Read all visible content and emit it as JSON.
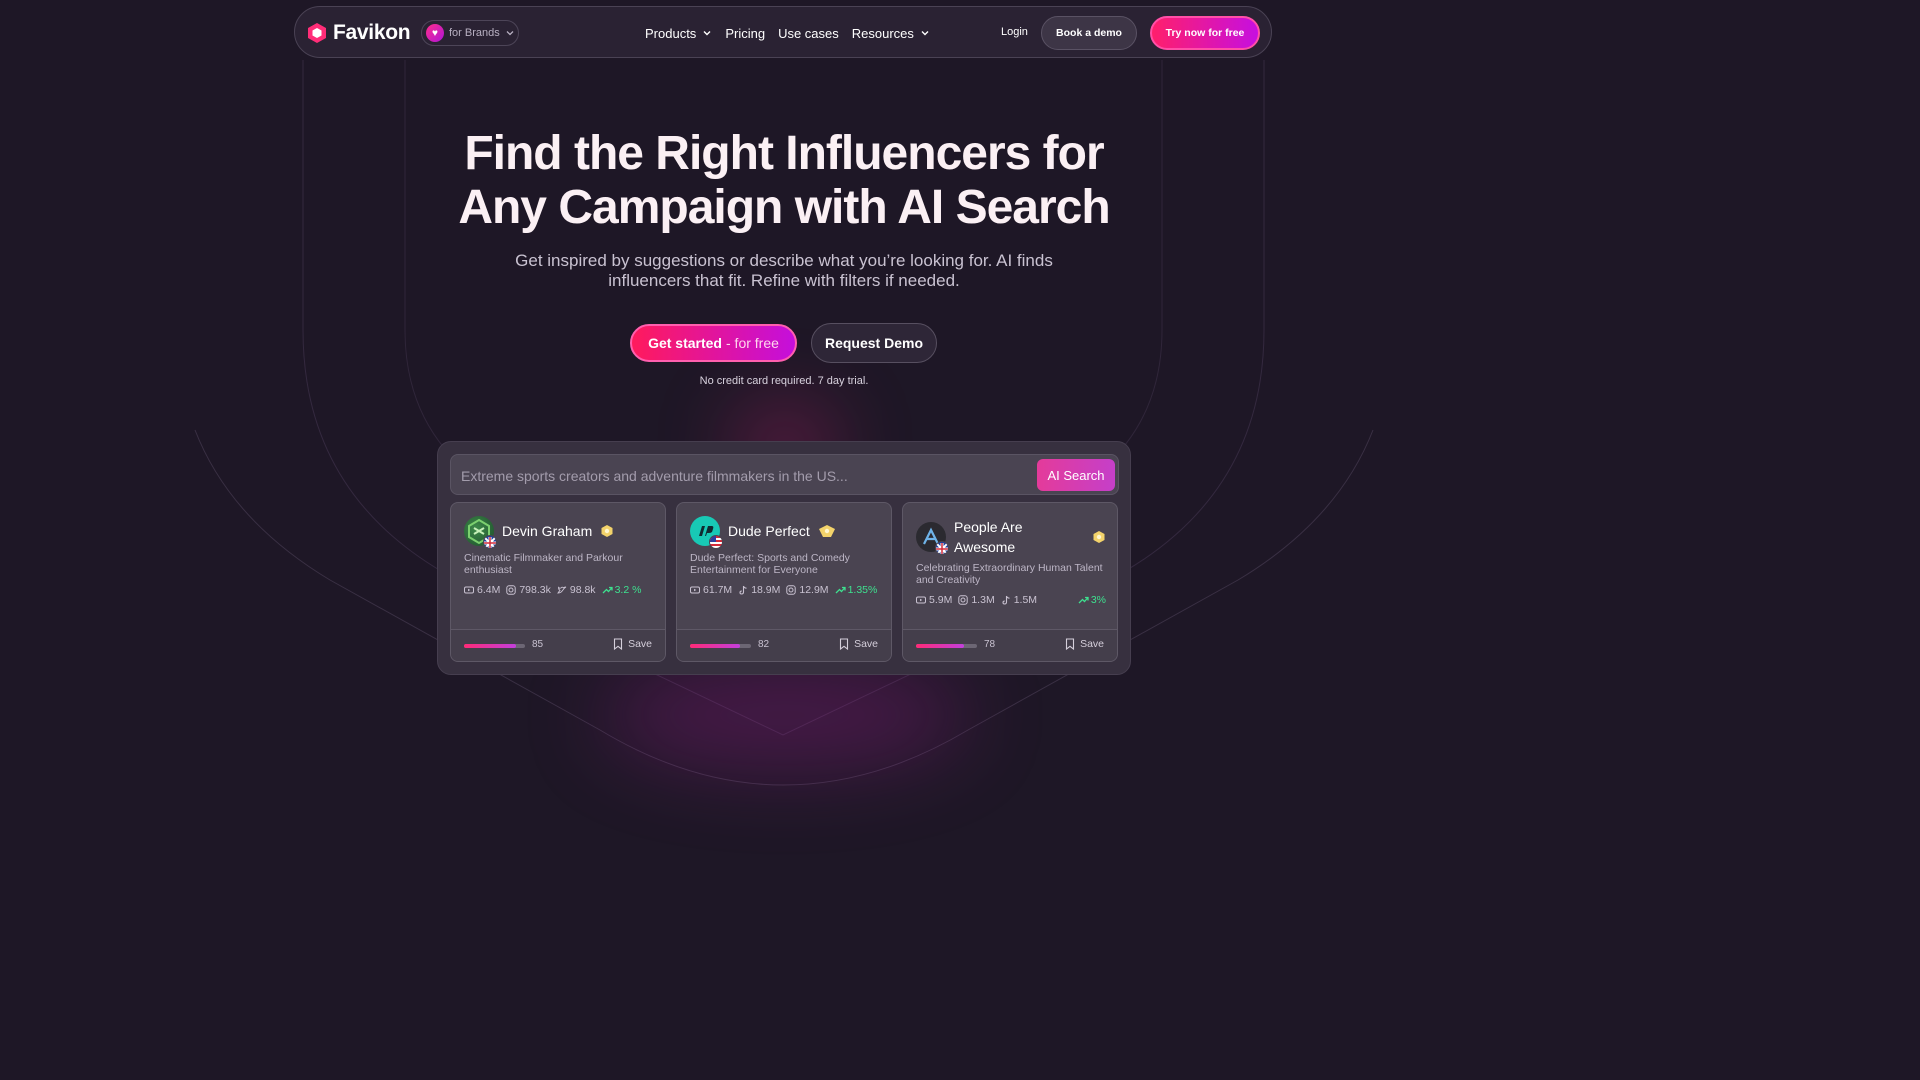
{
  "nav": {
    "logo_text": "Favikon",
    "brand_switch": "for Brands",
    "links": [
      "Products",
      "Pricing",
      "Use cases",
      "Resources"
    ],
    "login": "Login",
    "book_demo": "Book a demo",
    "try_now": "Try now for free"
  },
  "hero": {
    "headline_line1": "Find the Right Influencers for",
    "headline_line2": "Any Campaign with AI Search",
    "subline_line1": "Get inspired by suggestions or describe what you’re looking for. AI finds",
    "subline_line2": "influencers that fit. Refine with filters if needed.",
    "cta_primary": "Get started",
    "cta_primary_suffix": "- for free",
    "cta_secondary": "Request Demo",
    "note": "No credit card required. 7 day trial."
  },
  "search": {
    "placeholder": "Extreme sports creators and adventure filmmakers in the US...",
    "button": "AI Search"
  },
  "cards": [
    {
      "name": "Devin Graham",
      "description": "Cinematic Filmmaker and Parkour enthusiast",
      "stat1": "6.4M",
      "stat2": "798.3k",
      "stat3": "98.8k",
      "growth": "3.2 %",
      "score": "85",
      "score_fraction": 0.85,
      "save": "Save"
    },
    {
      "name": "Dude Perfect",
      "description": "Dude Perfect: Sports and Comedy Entertainment for Everyone",
      "stat1": "61.7M",
      "stat2": "18.9M",
      "stat3": "12.9M",
      "growth": "1.35%",
      "score": "82",
      "score_fraction": 0.82,
      "save": "Save"
    },
    {
      "name": "People Are Awesome",
      "description": "Celebrating Extraordinary Human Talent and Creativity",
      "stat1": "5.9M",
      "stat2": "1.3M",
      "stat3": "1.5M",
      "growth": "3%",
      "score": "78",
      "score_fraction": 0.78,
      "save": "Save"
    }
  ],
  "colors": {
    "background": "#1e1726",
    "accent_pink": "#ff1f6b",
    "accent_purple": "#c60fe0",
    "growth_green": "#3ee08f"
  }
}
